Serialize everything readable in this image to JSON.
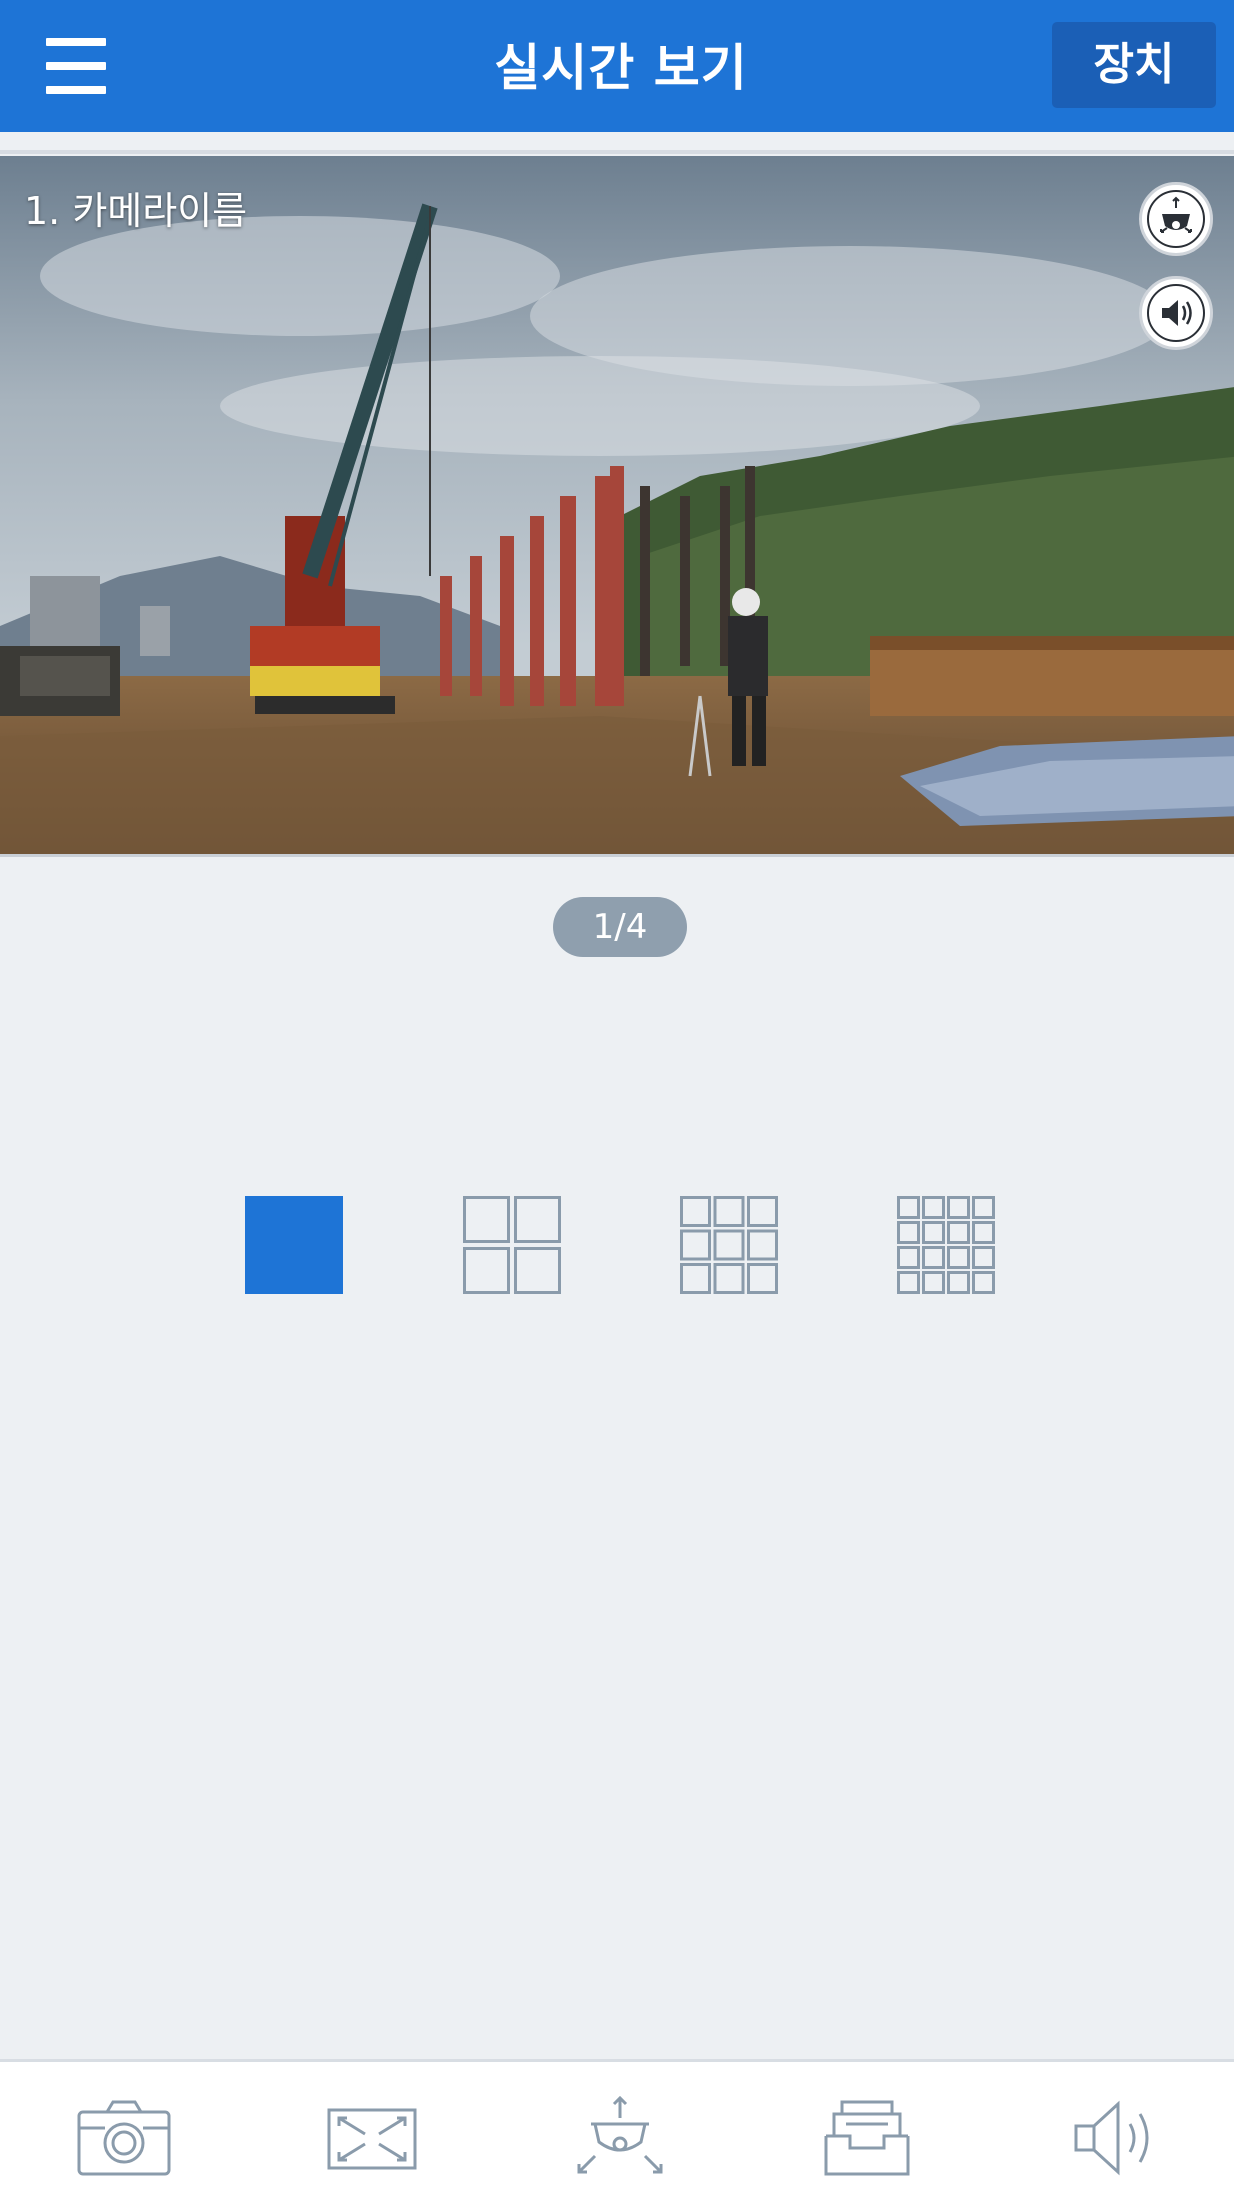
{
  "header": {
    "title": "실시간 보기",
    "device_button_label": "장치",
    "menu_icon": "hamburger-menu-icon"
  },
  "video": {
    "camera_label": "1. 카메라이름",
    "controls": [
      {
        "name": "ptz-control-icon"
      },
      {
        "name": "speaker-icon"
      }
    ]
  },
  "pagination": {
    "label": "1/4",
    "current": 1,
    "total": 4
  },
  "layouts": [
    {
      "name": "layout-1x1-icon",
      "grid": 1,
      "selected": true
    },
    {
      "name": "layout-2x2-icon",
      "grid": 2,
      "selected": false
    },
    {
      "name": "layout-3x3-icon",
      "grid": 3,
      "selected": false
    },
    {
      "name": "layout-4x4-icon",
      "grid": 4,
      "selected": false
    }
  ],
  "toolbar": [
    {
      "name": "snapshot-camera-icon"
    },
    {
      "name": "fullscreen-icon"
    },
    {
      "name": "ptz-icon"
    },
    {
      "name": "archive-tray-icon"
    },
    {
      "name": "audio-speaker-icon"
    }
  ],
  "colors": {
    "accent": "#1e74d6",
    "background": "#edf0f3",
    "icon_gray": "#8a9bab",
    "indicator_bg": "#8f9fae"
  }
}
